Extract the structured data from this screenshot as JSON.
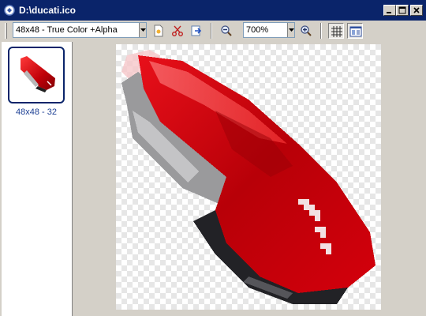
{
  "window": {
    "title": "D:\\ducati.ico"
  },
  "toolbar": {
    "format_selected": "48x48 - True Color +Alpha",
    "zoom_selected": "700%"
  },
  "thumbnails": [
    {
      "caption": "48x48 - 32"
    }
  ],
  "colors": {
    "titlebar": "#0a246a",
    "object_red": "#c8000a",
    "selection_border": "#0a246a"
  }
}
